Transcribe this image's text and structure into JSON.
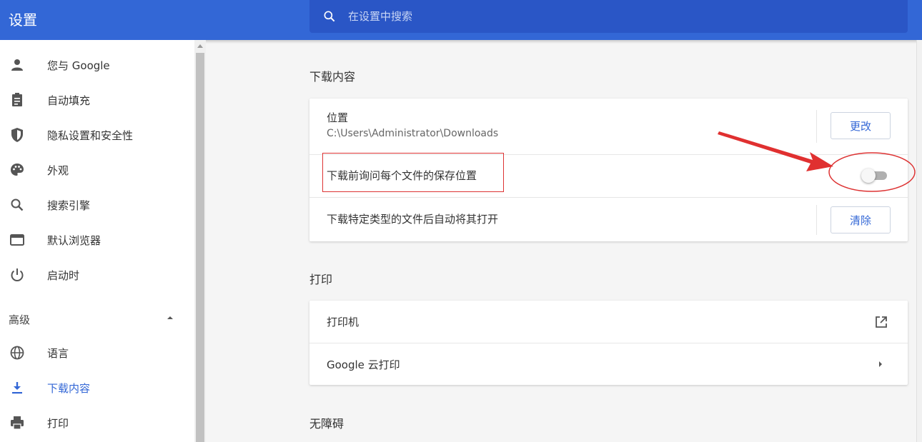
{
  "header": {
    "title": "设置",
    "search_placeholder": "在设置中搜索"
  },
  "sidebar": {
    "items": [
      {
        "label": "您与 Google",
        "icon": "person-icon"
      },
      {
        "label": "自动填充",
        "icon": "clipboard-icon"
      },
      {
        "label": "隐私设置和安全性",
        "icon": "shield-icon"
      },
      {
        "label": "外观",
        "icon": "palette-icon"
      },
      {
        "label": "搜索引擎",
        "icon": "search-icon"
      },
      {
        "label": "默认浏览器",
        "icon": "browser-icon"
      },
      {
        "label": "启动时",
        "icon": "power-icon"
      }
    ],
    "advanced_label": "高级",
    "advanced_items": [
      {
        "label": "语言",
        "icon": "globe-icon"
      },
      {
        "label": "下载内容",
        "icon": "download-icon",
        "active": true
      },
      {
        "label": "打印",
        "icon": "printer-icon"
      }
    ]
  },
  "downloads": {
    "title": "下载内容",
    "location_label": "位置",
    "location_path": "C:\\Users\\Administrator\\Downloads",
    "change_button": "更改",
    "ask_label": "下载前询问每个文件的保存位置",
    "ask_enabled": false,
    "auto_open_label": "下载特定类型的文件后自动将其打开",
    "clear_button": "清除"
  },
  "print": {
    "title": "打印",
    "printers_label": "打印机",
    "cloud_print_label": "Google 云打印"
  },
  "accessibility": {
    "title": "无障碍"
  },
  "colors": {
    "header_bg": "#3367d6",
    "accent": "#3367d6",
    "annotation": "#e03030"
  }
}
